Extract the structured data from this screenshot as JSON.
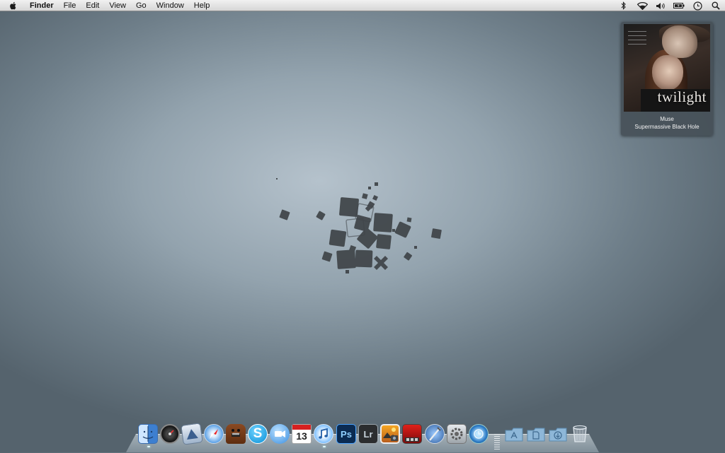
{
  "menubar": {
    "app_name": "Finder",
    "menus": [
      "File",
      "Edit",
      "View",
      "Go",
      "Window",
      "Help"
    ],
    "status_icons": [
      "bluetooth-icon",
      "wifi-icon",
      "volume-icon",
      "battery-icon",
      "time-machine-icon",
      "spotlight-icon"
    ]
  },
  "now_playing": {
    "album_art_title": "twilight",
    "artist": "Muse",
    "track": "Supermassive Black Hole"
  },
  "dock": {
    "apps": [
      {
        "icon": "finder-icon",
        "running": true
      },
      {
        "icon": "dashboard-icon",
        "running": false
      },
      {
        "icon": "mail-icon",
        "running": false
      },
      {
        "icon": "safari-icon",
        "running": false
      },
      {
        "icon": "domo-icon",
        "running": false
      },
      {
        "icon": "skype-icon",
        "running": false
      },
      {
        "icon": "ichat-icon",
        "running": false
      },
      {
        "icon": "ical-icon",
        "label": "13",
        "running": false
      },
      {
        "icon": "itunes-icon",
        "running": true
      },
      {
        "icon": "photoshop-icon",
        "label": "Ps",
        "running": false
      },
      {
        "icon": "lightroom-icon",
        "label": "Lr",
        "running": false
      },
      {
        "icon": "iphoto-icon",
        "running": false
      },
      {
        "icon": "photo-booth-icon",
        "running": false
      },
      {
        "icon": "xcode-icon",
        "running": false
      },
      {
        "icon": "system-preferences-icon",
        "running": false
      },
      {
        "icon": "time-machine-icon",
        "running": false
      }
    ],
    "stacks": [
      {
        "icon": "applications-folder-icon"
      },
      {
        "icon": "documents-folder-icon"
      },
      {
        "icon": "downloads-folder-icon"
      },
      {
        "icon": "trash-icon"
      }
    ]
  },
  "colors": {
    "wallpaper_center": "#b5c2cc",
    "wallpaper_edge": "#55636d",
    "deco_square": "#3f4448"
  }
}
